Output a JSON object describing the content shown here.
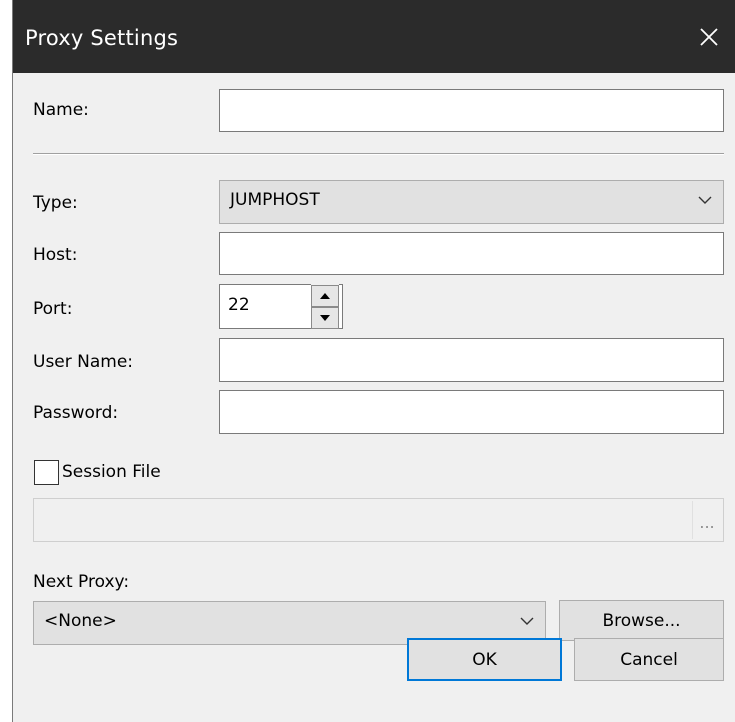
{
  "window": {
    "title": "Proxy Settings"
  },
  "form": {
    "name_label": "Name:",
    "name_value": "",
    "type_label": "Type:",
    "type_value": "JUMPHOST",
    "host_label": "Host:",
    "host_value": "",
    "port_label": "Port:",
    "port_value": "22",
    "username_label": "User Name:",
    "username_value": "",
    "password_label": "Password:",
    "password_value": "",
    "session_file_label": "Session File",
    "session_file_checked": false,
    "session_file_path": "",
    "ellipsis_label": "...",
    "next_proxy_label": "Next Proxy:",
    "next_proxy_value": "<None>"
  },
  "buttons": {
    "browse": "Browse...",
    "ok": "OK",
    "cancel": "Cancel"
  },
  "icons": {
    "close": "close-icon",
    "dropdown": "chevron-down-icon",
    "spin_up": "triangle-up-icon",
    "spin_down": "triangle-down-icon"
  },
  "colors": {
    "titlebar": "#2b2b2b",
    "dialog_bg": "#f0f0f0",
    "default_button_border": "#0078d7"
  }
}
